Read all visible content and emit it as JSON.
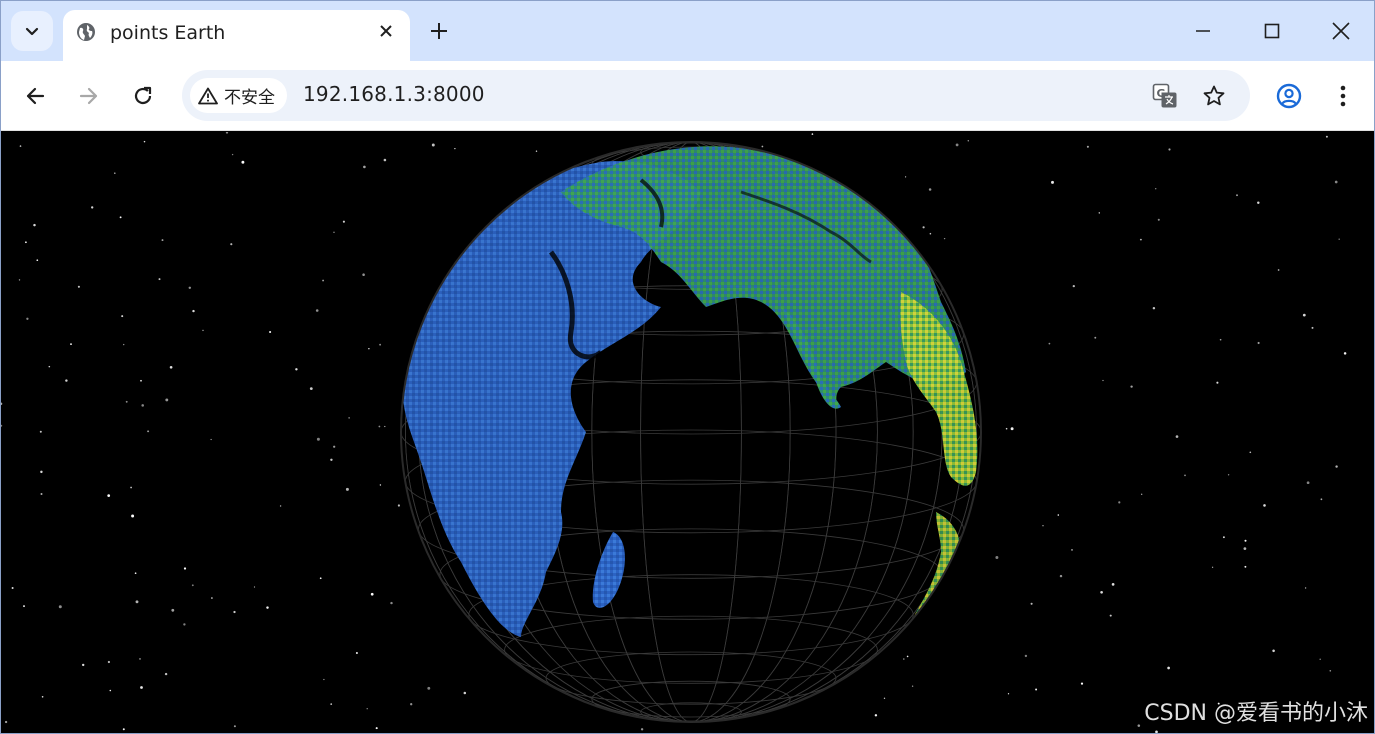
{
  "tab": {
    "title": "points Earth",
    "favicon": "globe-icon"
  },
  "toolbar": {
    "security_label": "不安全",
    "url": "192.168.1.3:8000"
  },
  "icons": {
    "tab_search": "chevron-down-icon",
    "close_tab": "close-icon",
    "new_tab": "plus-icon",
    "minimize": "minimize-icon",
    "maximize": "maximize-icon",
    "close_window": "close-icon",
    "back": "arrow-left-icon",
    "forward": "arrow-right-icon",
    "reload": "reload-icon",
    "warning": "warning-icon",
    "translate": "translate-icon",
    "bookmark": "star-icon",
    "profile": "profile-icon",
    "menu": "more-vert-icon"
  },
  "watermark": "CSDN @爱看书的小沐",
  "colors": {
    "tabstrip": "#d3e3fd",
    "omnibox": "#edf2fa",
    "ocean_blue": "#2f6fd0",
    "land_green": "#3ea34a",
    "land_yellow": "#d8d23a",
    "wireframe": "#3a3a3a",
    "space": "#000000"
  }
}
